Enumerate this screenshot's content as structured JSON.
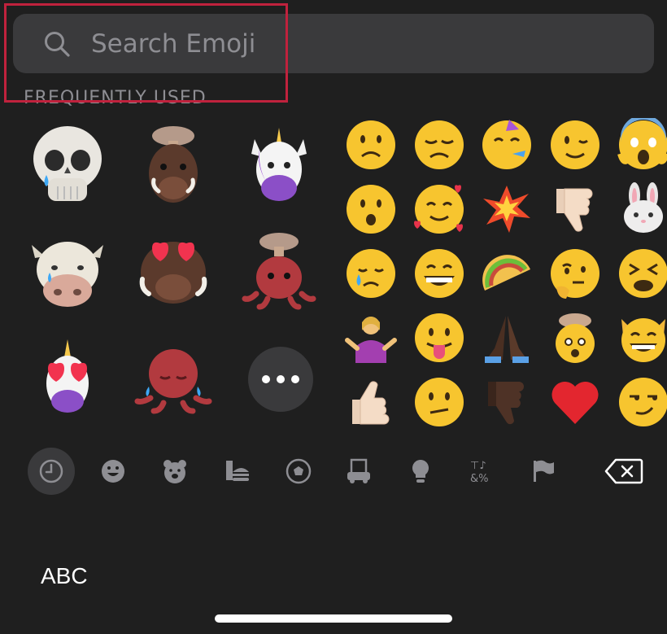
{
  "search": {
    "placeholder": "Search Emoji",
    "icon": "search-icon"
  },
  "section": {
    "frequently_used": "FREQUENTLY USED"
  },
  "memoji": [
    {
      "name": "memoji-skull-crying",
      "desc": "skull"
    },
    {
      "name": "memoji-boar-mind-blown",
      "desc": "boar"
    },
    {
      "name": "memoji-unicorn",
      "desc": "unicorn"
    },
    {
      "name": "memoji-cow-crying",
      "desc": "cow"
    },
    {
      "name": "memoji-boar-heart-eyes",
      "desc": "boar"
    },
    {
      "name": "memoji-octopus-mind-blown",
      "desc": "octopus"
    },
    {
      "name": "memoji-unicorn-heart-eyes",
      "desc": "unicorn"
    },
    {
      "name": "memoji-octopus-crying",
      "desc": "octopus"
    }
  ],
  "emoji_grid": [
    "slightly-frowning-face",
    "disappointed-face",
    "partying-face",
    "winking-face",
    "face-screaming-in-fear",
    "face-with-open-mouth",
    "smiling-face-with-hearts",
    "collision",
    "thumbs-down-light",
    "rabbit-face",
    "crying-face",
    "grinning-face-with-smiling-eyes",
    "taco",
    "thinking-face",
    "tired-face",
    "person-shrugging",
    "face-with-tongue",
    "folded-hands-dark",
    "exploding-head",
    "grinning-cat",
    "thumbs-up-light",
    "confused-face",
    "thumbs-down-dark",
    "red-heart",
    "smirking-face"
  ],
  "categories": [
    {
      "name": "clock-icon",
      "label": "Frequently Used",
      "active": true
    },
    {
      "name": "smiley-icon",
      "label": "Smileys & People"
    },
    {
      "name": "bear-icon",
      "label": "Animals & Nature"
    },
    {
      "name": "burger-icon",
      "label": "Food & Drink"
    },
    {
      "name": "soccer-ball-icon",
      "label": "Activity"
    },
    {
      "name": "building-icon",
      "label": "Travel & Places"
    },
    {
      "name": "lightbulb-icon",
      "label": "Objects"
    },
    {
      "name": "symbols-icon",
      "label": "Symbols"
    },
    {
      "name": "flag-icon",
      "label": "Flags"
    }
  ],
  "keyboard": {
    "abc_label": "ABC",
    "delete_icon": "delete-icon"
  },
  "colors": {
    "background": "#1f1f1f",
    "search_bg": "#3a3a3c",
    "highlight": "#c0223d",
    "muted": "#8e8e93"
  }
}
